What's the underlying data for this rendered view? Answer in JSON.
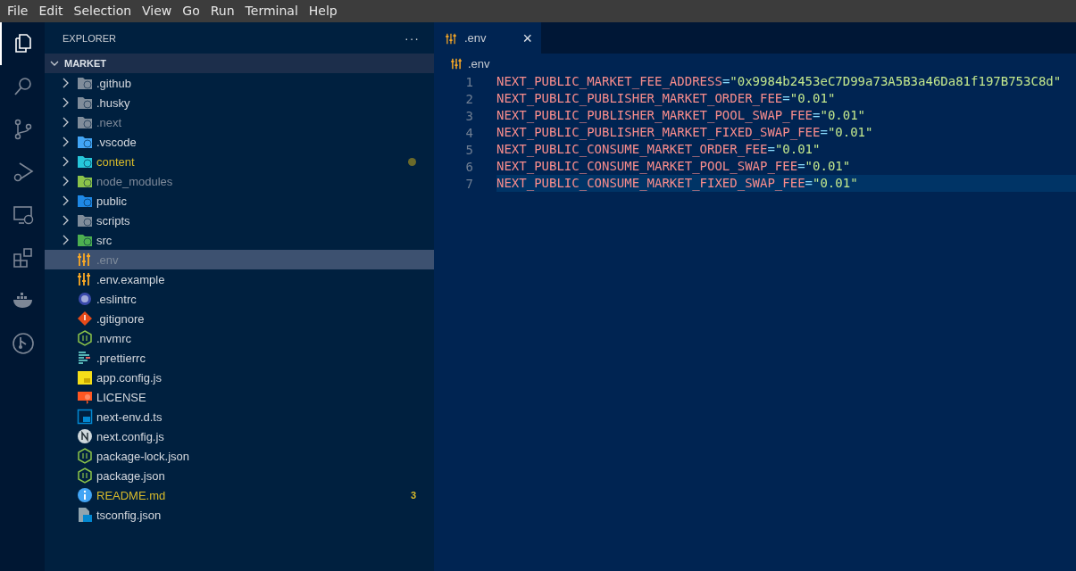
{
  "menu_bar": [
    "File",
    "Edit",
    "Selection",
    "View",
    "Go",
    "Run",
    "Terminal",
    "Help"
  ],
  "activity_bar": [
    {
      "kind": "files",
      "selected": true
    },
    {
      "kind": "search",
      "selected": false
    },
    {
      "kind": "branch",
      "selected": false
    },
    {
      "kind": "debug",
      "selected": false
    },
    {
      "kind": "monitor",
      "selected": false
    },
    {
      "kind": "blocks",
      "selected": false
    },
    {
      "kind": "whale",
      "selected": false
    },
    {
      "kind": "graph",
      "selected": false
    }
  ],
  "sidebar": {
    "title": "EXPLORER",
    "more": "···",
    "folder": {
      "name": "MARKET",
      "expanded": true
    },
    "items": [
      {
        "kind": "folder",
        "name": ".github",
        "color": "#7f8c9a",
        "expanded": false,
        "selected": false,
        "modified": false,
        "ignored": false
      },
      {
        "kind": "folder",
        "name": ".husky",
        "color": "#7f8c9a",
        "expanded": false,
        "selected": false,
        "modified": false,
        "ignored": false
      },
      {
        "kind": "folder",
        "name": ".next",
        "color": "#7f8c9a",
        "expanded": false,
        "selected": false,
        "modified": false,
        "ignored": true
      },
      {
        "kind": "folder",
        "name": ".vscode",
        "color": "#42a5f5",
        "expanded": false,
        "selected": false,
        "modified": false,
        "ignored": false
      },
      {
        "kind": "folder",
        "name": "content",
        "color": "#26c6da",
        "expanded": false,
        "selected": false,
        "modified": true,
        "ignored": false
      },
      {
        "kind": "folder",
        "name": "node_modules",
        "color": "#8bc34a",
        "expanded": false,
        "selected": false,
        "modified": false,
        "ignored": true
      },
      {
        "kind": "folder",
        "name": "public",
        "color": "#1e88e5",
        "expanded": false,
        "selected": false,
        "modified": false,
        "ignored": false
      },
      {
        "kind": "folder",
        "name": "scripts",
        "color": "#7f8c9a",
        "expanded": false,
        "selected": false,
        "modified": false,
        "ignored": false
      },
      {
        "kind": "folder",
        "name": "src",
        "color": "#4caf50",
        "expanded": false,
        "selected": false,
        "modified": false,
        "ignored": false
      },
      {
        "kind": "sliders",
        "name": ".env",
        "selected": true,
        "modified": false,
        "ignored": true
      },
      {
        "kind": "sliders",
        "name": ".env.example",
        "selected": false,
        "modified": false,
        "ignored": false
      },
      {
        "kind": "ring",
        "name": ".eslintrc",
        "selected": false,
        "modified": false,
        "ignored": false
      },
      {
        "kind": "diamond",
        "name": ".gitignore",
        "selected": false,
        "modified": false,
        "ignored": false
      },
      {
        "kind": "hexagon",
        "name": ".nvmrc",
        "selected": false,
        "modified": false,
        "ignored": false
      },
      {
        "kind": "bars",
        "name": ".prettierrc",
        "selected": false,
        "modified": false,
        "ignored": false
      },
      {
        "kind": "js",
        "name": "app.config.js",
        "selected": false,
        "modified": false,
        "ignored": false
      },
      {
        "kind": "certificate",
        "name": "LICENSE",
        "selected": false,
        "modified": false,
        "ignored": false
      },
      {
        "kind": "ts",
        "name": "next-env.d.ts",
        "selected": false,
        "modified": false,
        "ignored": false
      },
      {
        "kind": "ncircle",
        "name": "next.config.js",
        "selected": false,
        "modified": false,
        "ignored": false
      },
      {
        "kind": "hexagon",
        "name": "package-lock.json",
        "selected": false,
        "modified": false,
        "ignored": false
      },
      {
        "kind": "hexagon",
        "name": "package.json",
        "selected": false,
        "modified": false,
        "ignored": false
      },
      {
        "kind": "info",
        "name": "README.md",
        "selected": false,
        "modified": true,
        "ignored": false,
        "badge": "3"
      },
      {
        "kind": "tsfile",
        "name": "tsconfig.json",
        "selected": false,
        "modified": false,
        "ignored": false
      }
    ]
  },
  "tabs": [
    {
      "label": ".env",
      "close": "×",
      "selected": true
    }
  ],
  "breadcrumb": ".env",
  "editor": {
    "lines": [
      {
        "number": "1",
        "key": "NEXT_PUBLIC_MARKET_FEE_ADDRESS",
        "op": "=",
        "value": "\"0x9984b2453eC7D99a73A5B3a46Da81f197B753C8d\"",
        "selected": false
      },
      {
        "number": "2",
        "key": "NEXT_PUBLIC_PUBLISHER_MARKET_ORDER_FEE",
        "op": "=",
        "value": "\"0.01\"",
        "selected": false
      },
      {
        "number": "3",
        "key": "NEXT_PUBLIC_PUBLISHER_MARKET_POOL_SWAP_FEE",
        "op": "=",
        "value": "\"0.01\"",
        "selected": false
      },
      {
        "number": "4",
        "key": "NEXT_PUBLIC_PUBLISHER_MARKET_FIXED_SWAP_FEE",
        "op": "=",
        "value": "\"0.01\"",
        "selected": false
      },
      {
        "number": "5",
        "key": "NEXT_PUBLIC_CONSUME_MARKET_ORDER_FEE",
        "op": "=",
        "value": "\"0.01\"",
        "selected": false
      },
      {
        "number": "6",
        "key": "NEXT_PUBLIC_CONSUME_MARKET_POOL_SWAP_FEE",
        "op": "=",
        "value": "\"0.01\"",
        "selected": false
      },
      {
        "number": "7",
        "key": "NEXT_PUBLIC_CONSUME_MARKET_FIXED_SWAP_FEE",
        "op": "=",
        "value": "\"0.01\"",
        "selected": true
      }
    ]
  }
}
